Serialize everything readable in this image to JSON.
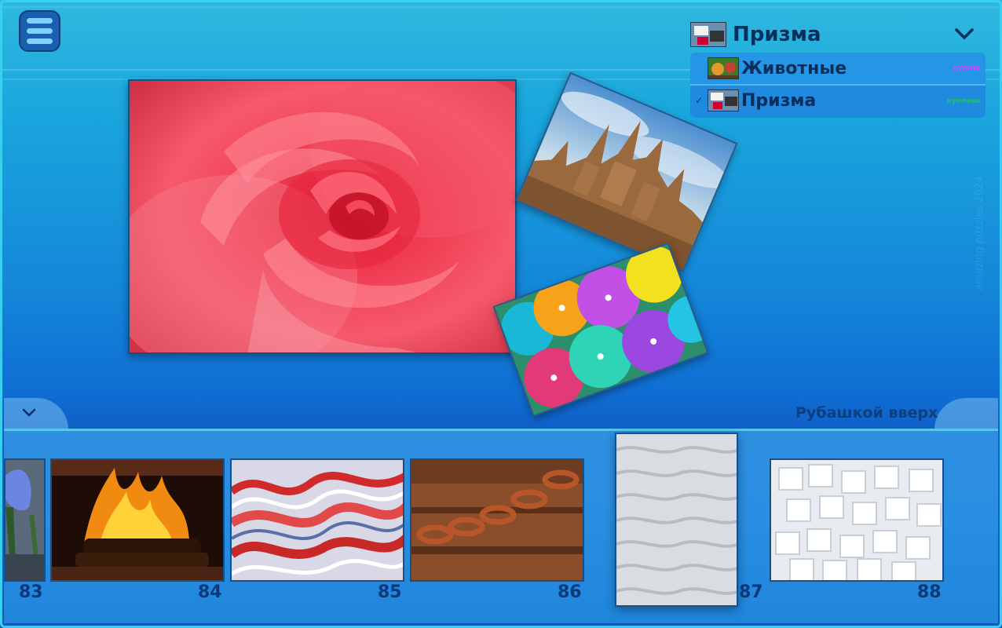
{
  "colors": {
    "accent": "#39d0f0",
    "label": "#0a3878",
    "status_purple": "#c050ff",
    "status_green": "#22c26a"
  },
  "menu": {
    "icon": "hamburger-menu-icon"
  },
  "collection_dropdown": {
    "selected": "Призма",
    "chevron_icon": "chevron-down-icon",
    "items": [
      {
        "label": "Животные",
        "status": "купить",
        "selected": false
      },
      {
        "label": "Призма",
        "status": "куплено",
        "selected": true,
        "check": "✓"
      }
    ]
  },
  "collapse_tab": {
    "icon": "chevron-down-icon"
  },
  "side_watermark": "amazing puzzles 2024",
  "status_text": "Рубашкой вверх",
  "thumbnails": [
    {
      "number": "83",
      "subject": "crocus"
    },
    {
      "number": "84",
      "subject": "fireplace"
    },
    {
      "number": "85",
      "subject": "agate"
    },
    {
      "number": "86",
      "subject": "rusty chain"
    },
    {
      "number": "87",
      "subject": "sand"
    },
    {
      "number": "88",
      "subject": "sugar cubes"
    }
  ]
}
